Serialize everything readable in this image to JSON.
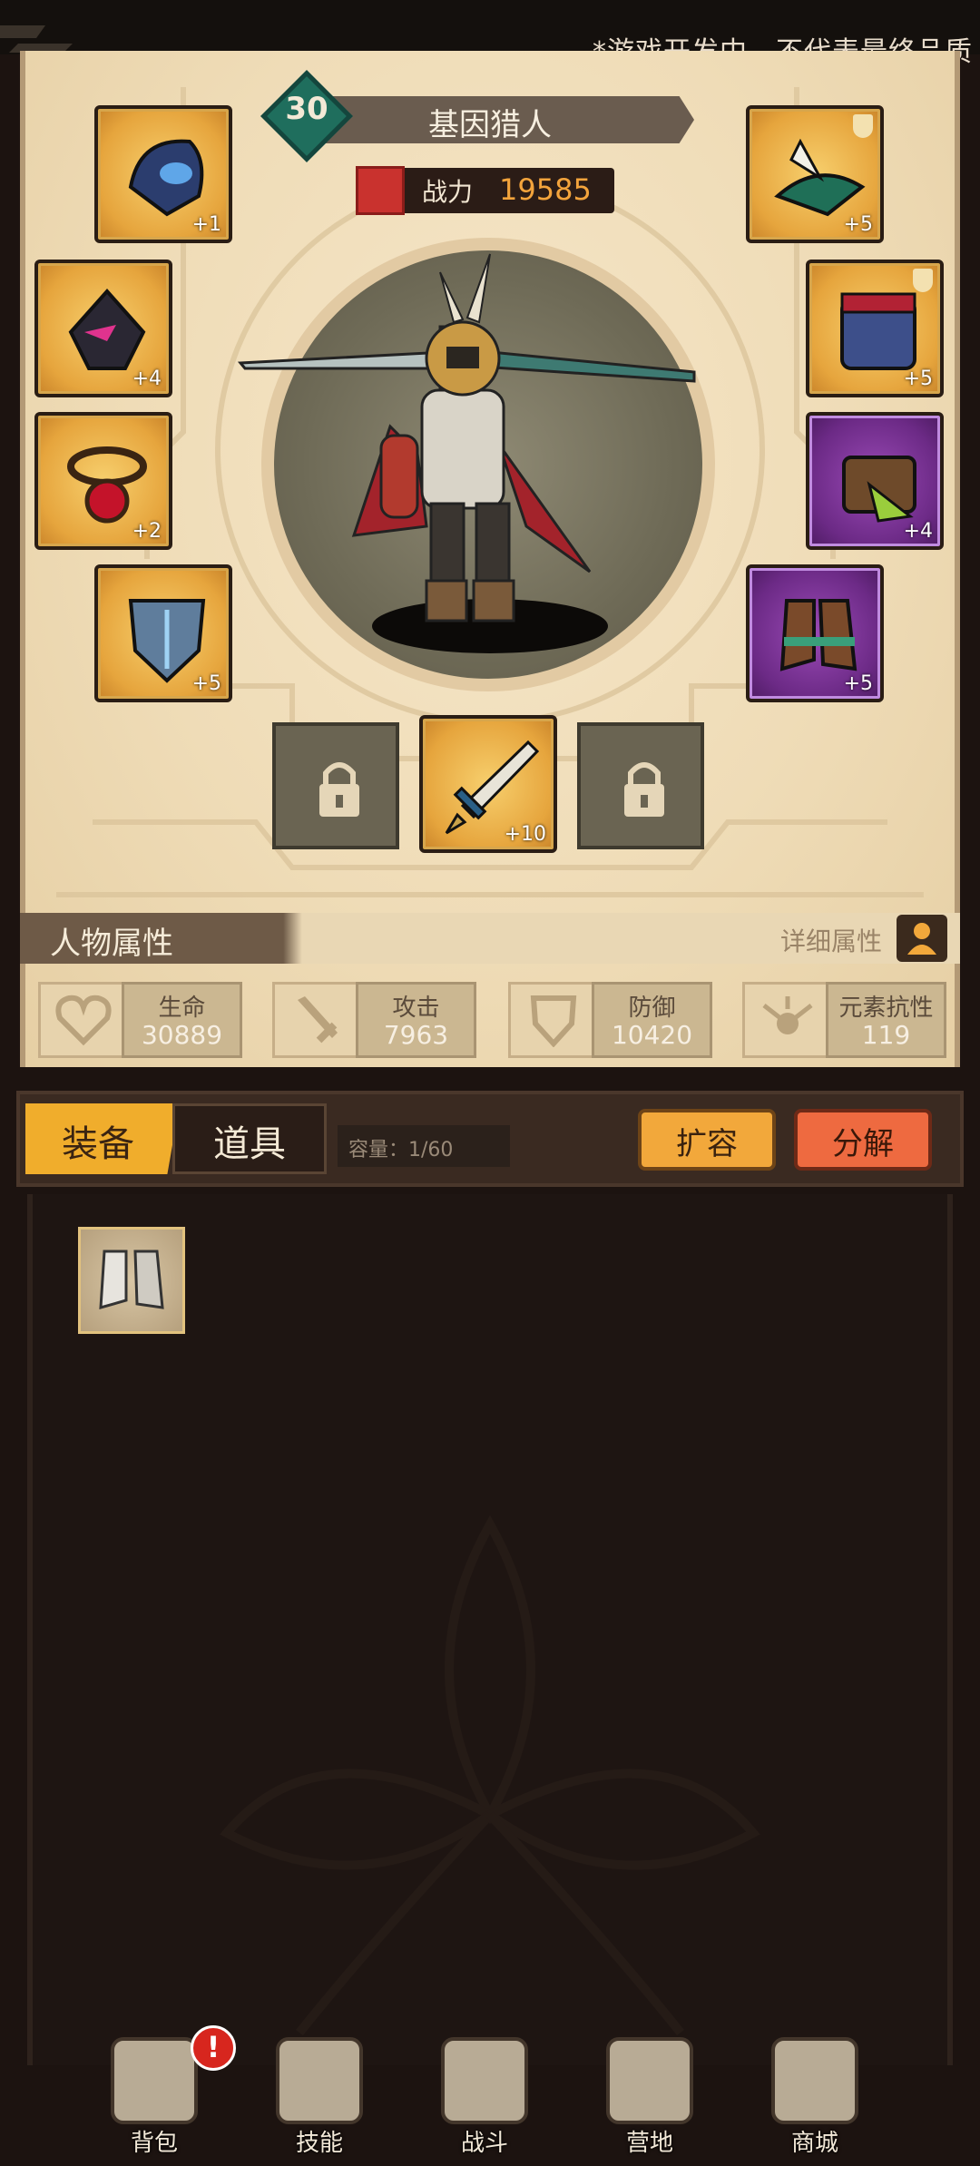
{
  "watermark": "*游戏开发中，不代表最终品质",
  "character": {
    "level": "30",
    "name": "基因猎人",
    "power_label": "战力",
    "power_value": "19585"
  },
  "equipment_left": [
    {
      "slot": "helmet",
      "plus": "+1",
      "rarity": "gold"
    },
    {
      "slot": "mask",
      "plus": "+4",
      "rarity": "gold"
    },
    {
      "slot": "amulet",
      "plus": "+2",
      "rarity": "gold"
    },
    {
      "slot": "shield",
      "plus": "+5",
      "rarity": "gold"
    }
  ],
  "equipment_right": [
    {
      "slot": "hat",
      "plus": "+5",
      "rarity": "gold"
    },
    {
      "slot": "armor",
      "plus": "+5",
      "rarity": "gold"
    },
    {
      "slot": "belt-pack",
      "plus": "+4",
      "rarity": "purple"
    },
    {
      "slot": "boots",
      "plus": "+5",
      "rarity": "purple"
    }
  ],
  "weapon": {
    "plus": "+10"
  },
  "attributes": {
    "title": "人物属性",
    "detail_label": "详细属性",
    "stats": [
      {
        "label": "生命",
        "value": "30889",
        "icon": "heart-icon"
      },
      {
        "label": "攻击",
        "value": "7963",
        "icon": "sword-icon"
      },
      {
        "label": "防御",
        "value": "10420",
        "icon": "shield-icon"
      },
      {
        "label": "元素抗性",
        "value": "119",
        "icon": "element-icon"
      }
    ]
  },
  "inventory": {
    "tab_equip": "装备",
    "tab_items": "道具",
    "capacity": "容量：1/60",
    "expand_label": "扩容",
    "decompose_label": "分解"
  },
  "nav": [
    {
      "label": "背包",
      "icon": "backpack-icon"
    },
    {
      "label": "技能",
      "icon": "skill-book-icon"
    },
    {
      "label": "战斗",
      "icon": "battle-icon"
    },
    {
      "label": "营地",
      "icon": "camp-castle-icon"
    },
    {
      "label": "商城",
      "icon": "shop-icon"
    }
  ],
  "nav_alert": "!",
  "colors": {
    "gold_slot": "#e6a53d",
    "purple_slot": "#6c2a86",
    "accent": "#f0ad2c",
    "decompose": "#ee6a40"
  }
}
